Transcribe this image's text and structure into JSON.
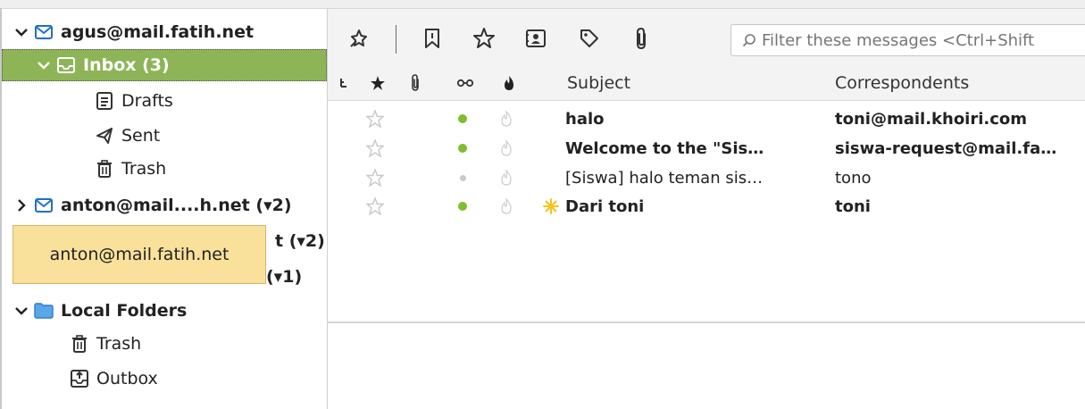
{
  "colors": {
    "selected_bg": "#8db557",
    "tooltip_bg": "#f9e19b",
    "unread_dot": "#7cbf2a",
    "read_dot": "#c9c9c9",
    "mail_icon": "#1f6fc9",
    "star_outline": "#c8c8c8",
    "junk_icon": "#cccccc",
    "new_spark": "#f6c31c"
  },
  "folders": {
    "acct1": {
      "label": "agus@mail.fatih.net",
      "icon": "envelope-icon"
    },
    "inbox": {
      "label": "Inbox (3)",
      "icon": "inbox-icon"
    },
    "drafts": {
      "label": "Drafts",
      "icon": "drafts-icon"
    },
    "sent": {
      "label": "Sent",
      "icon": "paper-plane-icon"
    },
    "trash1": {
      "label": "Trash",
      "icon": "trash-icon"
    },
    "acct2": {
      "label": "anton@mail....h.net (▾2)",
      "icon": "envelope-icon"
    },
    "hidden1": {
      "label": "t (▾2)"
    },
    "hidden2": {
      "label": "(▾1)"
    },
    "local": {
      "label": "Local Folders",
      "icon": "folder-icon"
    },
    "trash2": {
      "label": "Trash",
      "icon": "trash-icon"
    },
    "outbox": {
      "label": "Outbox",
      "icon": "outbox-icon"
    }
  },
  "tooltip": {
    "text": "anton@mail.fatih.net"
  },
  "toolbar": {
    "buttons": [
      "quick-filter-pin-icon",
      "unread-bookmark-icon",
      "starred-icon",
      "contact-card-icon",
      "tag-icon",
      "attachment-icon"
    ],
    "filter_placeholder": "Filter these messages <Ctrl+Shift"
  },
  "columns": {
    "subject": "Subject",
    "correspondents": "Correspondents"
  },
  "messages": [
    {
      "subject": "halo",
      "correspondent": "toni@mail.khoiri.com",
      "unread": true
    },
    {
      "subject": "Welcome to the \"Sis…",
      "correspondent": "siswa-request@mail.fa…",
      "unread": true
    },
    {
      "subject": "[Siswa] halo teman sis…",
      "correspondent": "tono",
      "unread": false
    },
    {
      "subject": "Dari toni",
      "correspondent": "toni",
      "unread": true,
      "new": true
    }
  ]
}
